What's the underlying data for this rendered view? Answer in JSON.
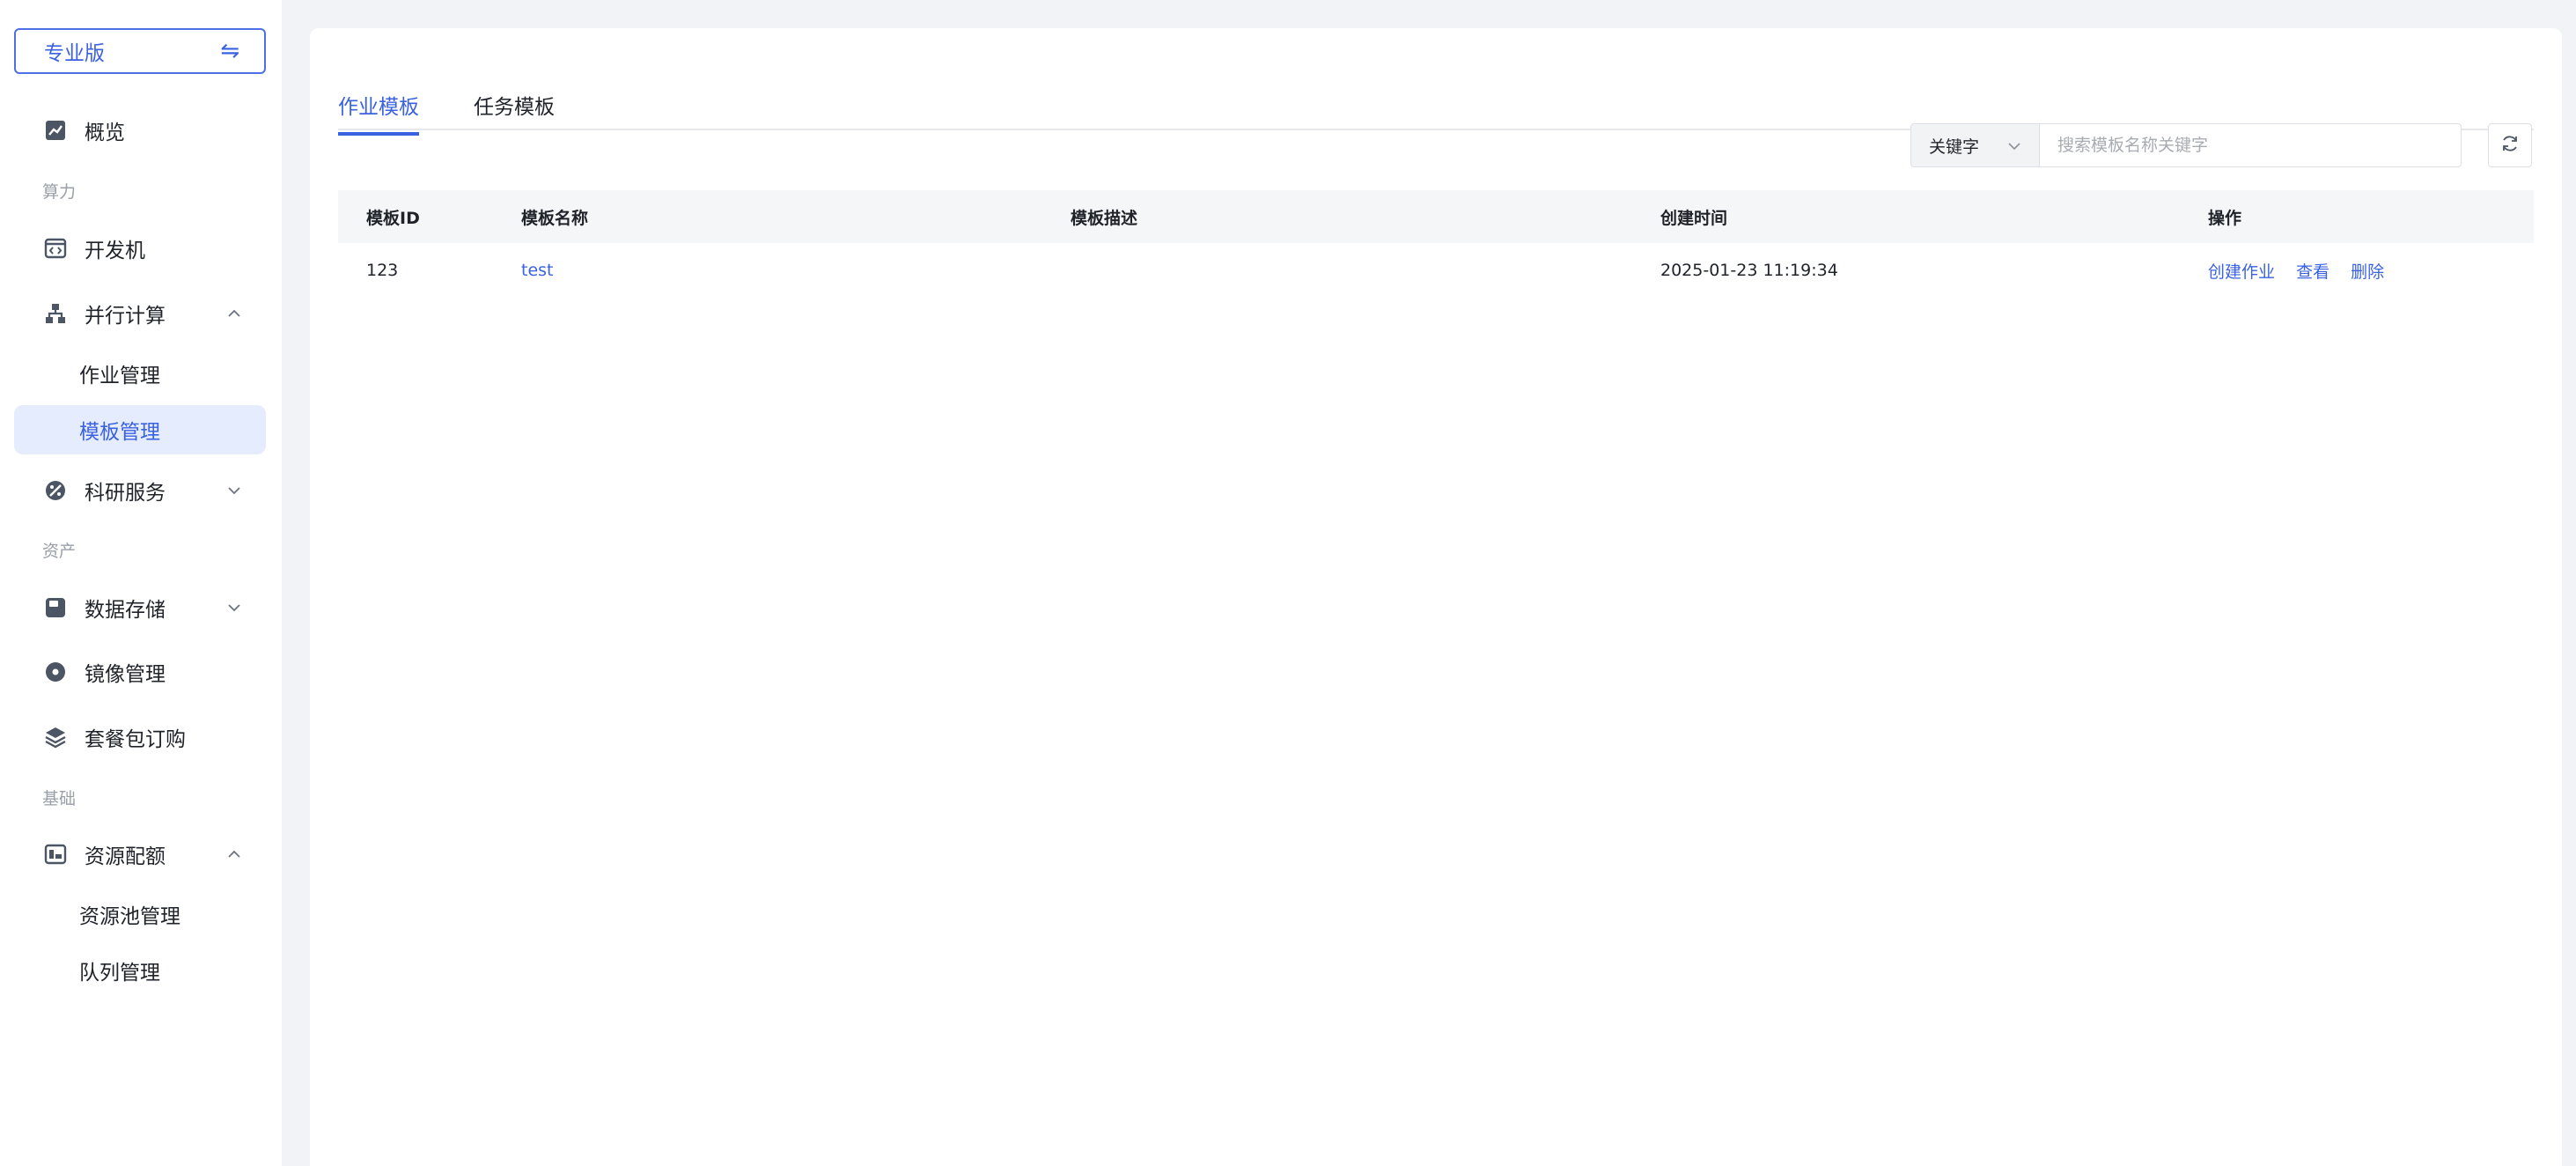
{
  "sidebar": {
    "edition_label": "专业版",
    "edition_swap_icon": "⇋",
    "items": {
      "overview": "概览",
      "section_compute": "算力",
      "devmachine": "开发机",
      "parallel": "并行计算",
      "parallel_job": "作业管理",
      "parallel_template": "模板管理",
      "research": "科研服务",
      "section_assets": "资产",
      "storage": "数据存储",
      "image": "镜像管理",
      "package": "套餐包订购",
      "section_basic": "基础",
      "quota": "资源配额",
      "quota_pool": "资源池管理",
      "quota_queue": "队列管理"
    }
  },
  "main": {
    "tabs": [
      "作业模板",
      "任务模板"
    ],
    "search": {
      "select_label": "关键字",
      "placeholder": "搜索模板名称关键字"
    },
    "table": {
      "columns": [
        "模板ID",
        "模板名称",
        "模板描述",
        "创建时间",
        "操作"
      ],
      "rows": [
        {
          "id": "123",
          "name": "test",
          "desc": "",
          "created": "2025-01-23 11:19:34",
          "actions": [
            "创建作业",
            "查看",
            "删除"
          ]
        }
      ]
    }
  },
  "colors": {
    "accent": "#3a62e0",
    "active_bg": "#e5ecfd",
    "page_bg": "#f2f3f6"
  }
}
